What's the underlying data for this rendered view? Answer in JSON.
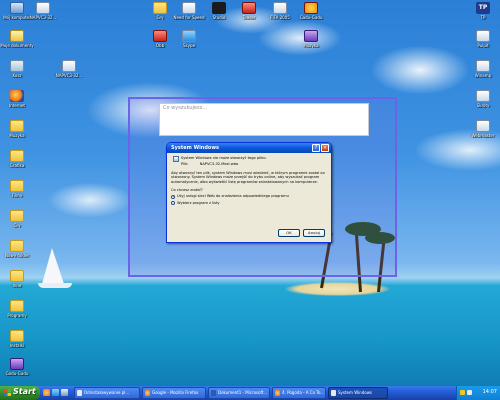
{
  "desktop": {
    "icons_left": [
      {
        "label": "Mój komputer",
        "icon": "computer-icon"
      },
      {
        "label": "Moje dokumenty",
        "icon": "folder-icon"
      },
      {
        "label": "Kosz",
        "icon": "recycle-bin-icon"
      },
      {
        "label": "Internet",
        "icon": "firefox-icon"
      },
      {
        "label": "Muzyka",
        "icon": "folder-icon"
      },
      {
        "label": "Grafika",
        "icon": "folder-icon"
      },
      {
        "label": "Filmy",
        "icon": "folder-icon"
      },
      {
        "label": "Gry",
        "icon": "folder-icon"
      },
      {
        "label": "Nowy folder",
        "icon": "folder-icon"
      },
      {
        "label": "Inne",
        "icon": "folder-icon"
      },
      {
        "label": "Programy",
        "icon": "folder-icon"
      },
      {
        "label": "Instalki",
        "icon": "folder-icon"
      },
      {
        "label": "Gadu-Gadu",
        "icon": "app-icon"
      }
    ],
    "second_column": [
      {
        "label": "NAPVC3-32...",
        "icon": "app-icon"
      },
      {
        "label": "NAPVC3-32...",
        "icon": "file-icon"
      }
    ],
    "icons_top": [
      {
        "label": "Gry",
        "icon": "folder-icon"
      },
      {
        "label": "Need for Speed",
        "icon": "app-icon"
      },
      {
        "label": "Studio",
        "icon": "star-icon"
      },
      {
        "label": "Teaser",
        "icon": "red-icon"
      },
      {
        "label": "FIFA 2005",
        "icon": "app-icon"
      },
      {
        "label": "Gadu-Gadu",
        "icon": "sun-icon"
      },
      {
        "label": "Obb",
        "icon": "red-icon"
      },
      {
        "label": "Skype",
        "icon": "app-icon"
      },
      {
        "label": "Muzyka",
        "icon": "purple-icon"
      }
    ],
    "icons_right": [
      {
        "label": "TP",
        "icon": "tp-icon"
      },
      {
        "label": "Pulpit",
        "icon": "app-icon"
      },
      {
        "label": "Winamp",
        "icon": "app-icon"
      },
      {
        "label": "Skróty",
        "icon": "app-icon"
      },
      {
        "label": "Webmaster",
        "icon": "app-icon"
      }
    ]
  },
  "search_overlay": {
    "placeholder": "Co wyszukujesz..."
  },
  "dialog": {
    "title": "System Windows",
    "message": "System Windows nie może otworzyć tego pliku:",
    "file_label": "Plik:",
    "file_name": "NAPVC3-32-Mezi.wba",
    "explanation": "Aby otworzyć ten plik, system Windows musi wiedzieć, w którym programie został on utworzony. System Windows może przejść do trybu online, aby wyszukać program automatycznie, albo wyświetlić listę programów zainstalowanych na komputerze.",
    "question": "Co chcesz zrobić?",
    "options": [
      {
        "label": "Użyj usługi sieci Web do znalezienia odpowiedniego programu",
        "selected": true
      },
      {
        "label": "Wybierz program z listy",
        "selected": false
      }
    ],
    "ok_label": "OK",
    "cancel_label": "Anuluj"
  },
  "taskbar": {
    "start_label": "Start",
    "tasks": [
      {
        "label": "Odinstalowywanie pl...",
        "active": false
      },
      {
        "label": "Google - Mozilla Firefox",
        "active": false
      },
      {
        "label": "Dokument1 - Microsoft...",
        "active": false
      },
      {
        "label": "4. Pogoda - A Co To...",
        "active": false
      },
      {
        "label": "System Windows",
        "active": true
      }
    ],
    "clock": "14:07"
  },
  "colors": {
    "sky": "#3f93e2",
    "sea": "#1796c8",
    "selection": "#6c63e8",
    "taskbar": "#245edb",
    "start": "#2f8a29",
    "dialog_bg": "#ece9d8"
  }
}
